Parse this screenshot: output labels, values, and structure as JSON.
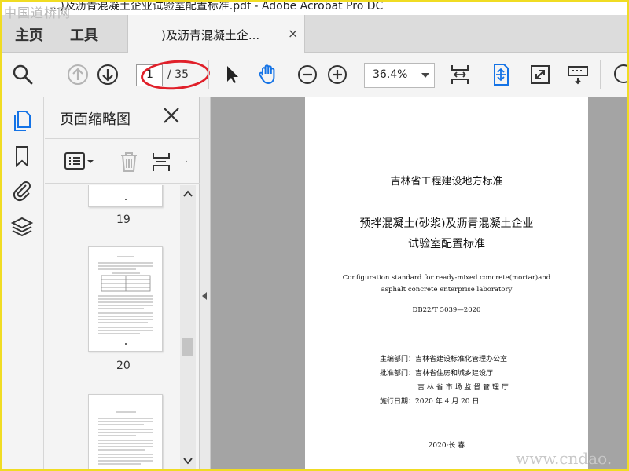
{
  "watermark_top": "中国道桥网",
  "window_title": "...)及沥青混凝土企业试验室配置标准.pdf - Adobe Acrobat Pro DC",
  "menu": {
    "home": "主页",
    "tools": "工具"
  },
  "tab": {
    "label": ")及沥青混凝土企...",
    "close": "×"
  },
  "toolbar": {
    "page_current": "1",
    "page_total": "/ 35",
    "zoom": "36.4%"
  },
  "thumbnails": {
    "title": "页面缩略图",
    "pages": [
      {
        "number": "19"
      },
      {
        "number": "20"
      },
      {
        "number": ""
      }
    ]
  },
  "document": {
    "org_title": "吉林省工程建设地方标准",
    "title_line1": "预拌混凝土(砂浆)及沥青混凝土企业",
    "title_line2": "试验室配置标准",
    "en_line1": "Configuration standard for ready-mixed concrete(mortar)and",
    "en_line2": "asphalt concrete enterprise laboratory",
    "code": "DB22/T 5039—2020",
    "dept1": "主编部门：吉林省建设标准化管理办公室",
    "dept2": "批准部门：吉林省住房和城乡建设厅",
    "dept3": "吉 林 省 市 场 监 督 管 理 厅",
    "date": "施行日期：2020 年 4 月 20 日",
    "place": "2020·长 春"
  },
  "watermark_bottom": "www.cndao.",
  "colors": {
    "accent": "#1473e6",
    "annotation": "#e0202a",
    "frame": "#f0dc23"
  }
}
